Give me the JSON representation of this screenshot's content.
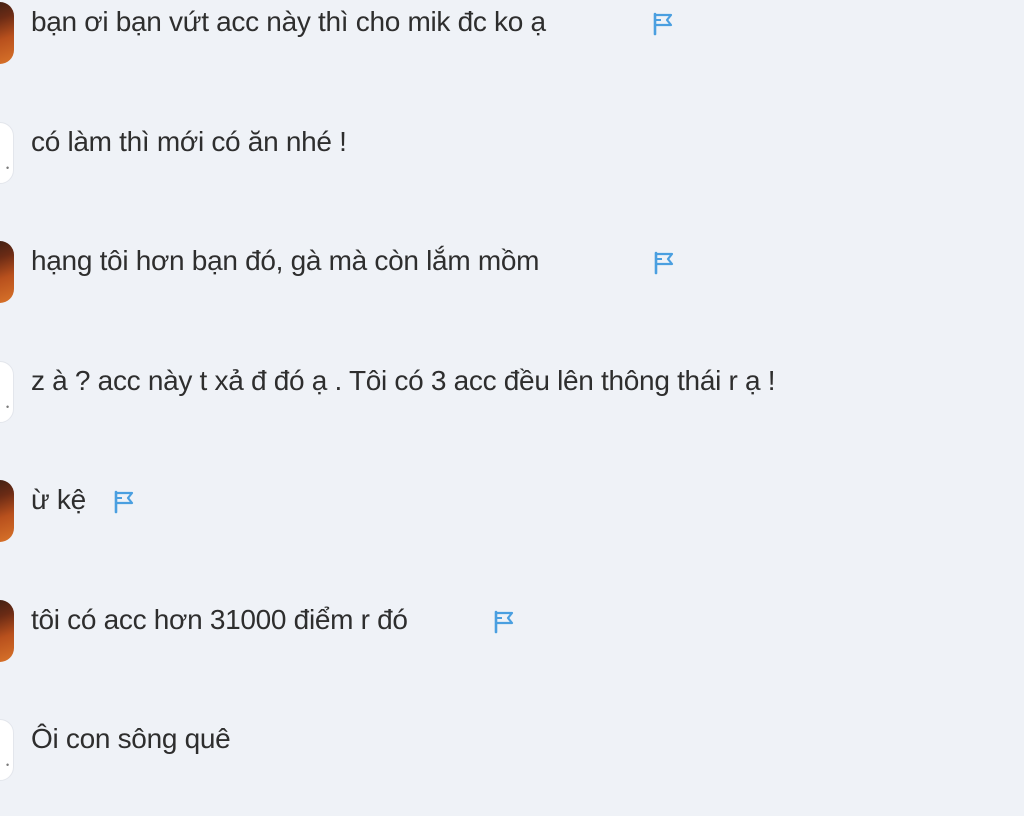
{
  "messages": [
    {
      "text": "bạn ơi bạn vứt acc này thì cho mik đc ko ạ",
      "avatar": "orange",
      "flag": true
    },
    {
      "text": "có làm thì mới có ăn nhé !",
      "avatar": "white",
      "flag": false
    },
    {
      "text": "hạng tôi hơn bạn đó, gà mà còn lắm mồm",
      "avatar": "orange",
      "flag": true
    },
    {
      "text": "z à ? acc này t xả đ đó ạ . Tôi có 3 acc đều lên thông thái r ạ !",
      "avatar": "white",
      "flag": false
    },
    {
      "text": "ừ kệ",
      "avatar": "orange",
      "flag": true
    },
    {
      "text": "tôi có acc hơn 31000 điểm r đó",
      "avatar": "orange",
      "flag": true
    },
    {
      "text": "Ôi con sông quê",
      "avatar": "white",
      "flag": false
    }
  ],
  "colors": {
    "background": "#eff2f7",
    "flag": "#4a9fe0",
    "text": "#2e2e2e"
  },
  "icons": {
    "flag": "flag-icon",
    "avatar": "avatar"
  }
}
